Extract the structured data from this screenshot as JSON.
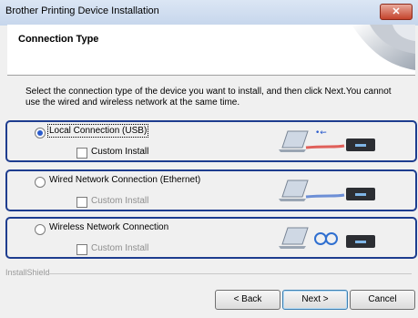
{
  "window": {
    "title": "Brother Printing Device Installation",
    "close_glyph": "✕"
  },
  "header": {
    "title": "Connection Type"
  },
  "instructions": "Select the connection type of the device you want to install, and then click Next.You cannot use the wired and wireless network at the same time.",
  "options": [
    {
      "label": "Local Connection (USB)",
      "selected": true,
      "custom_install": "Custom Install",
      "custom_enabled": true,
      "picture": "laptop-usb-printer"
    },
    {
      "label": "Wired Network Connection (Ethernet)",
      "selected": false,
      "custom_install": "Custom Install",
      "custom_enabled": false,
      "picture": "laptop-ethernet-printer"
    },
    {
      "label": "Wireless Network Connection",
      "selected": false,
      "custom_install": "Custom Install",
      "custom_enabled": false,
      "picture": "laptop-wireless-printer"
    }
  ],
  "footer": {
    "brand": "InstallShield"
  },
  "buttons": {
    "back": "< Back",
    "next": "Next >",
    "cancel": "Cancel"
  },
  "colors": {
    "highlight_border": "#1e3d8f",
    "usb_link": "#e0605a",
    "ethernet_link": "#6d8fd6",
    "wireless_link": "#2f6fd0"
  }
}
